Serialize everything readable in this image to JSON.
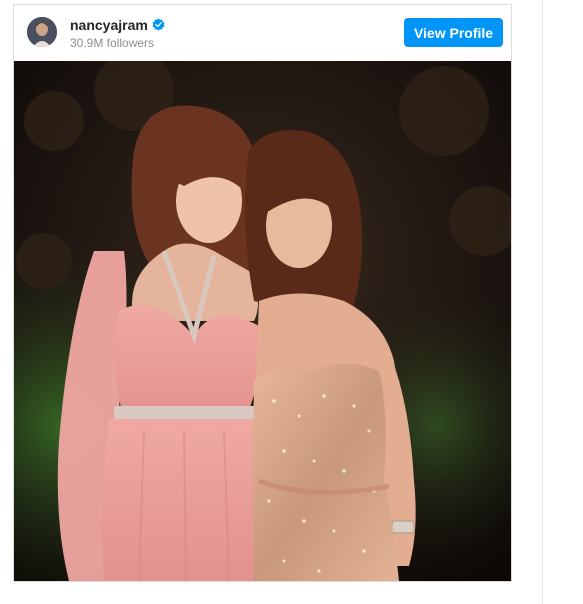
{
  "profile": {
    "username": "nancyajram",
    "verified_icon": "verified-badge-icon",
    "followers": "30.9M followers",
    "view_profile_label": "View Profile"
  },
  "colors": {
    "accent": "#0095f6",
    "verified": "#0095f6",
    "username": "#262626",
    "secondary_text": "#8e8e8e",
    "border": "#dbdbdb"
  },
  "photo": {
    "description_icon": "post-photo"
  }
}
